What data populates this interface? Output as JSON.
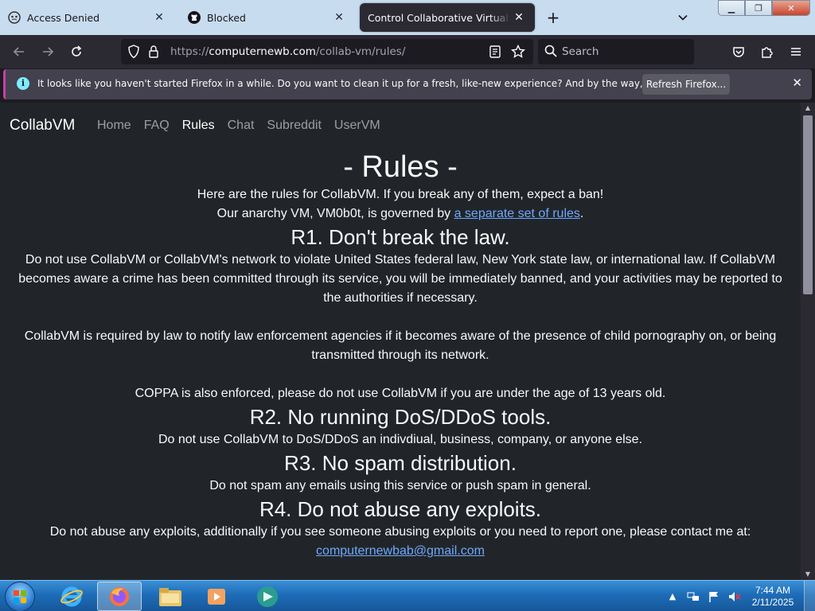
{
  "tabs": [
    {
      "label": "Access Denied",
      "icon": "mask-icon"
    },
    {
      "label": "Blocked",
      "icon": "github-icon"
    },
    {
      "label": "Control Collaborative Virtual Machi",
      "icon": "none",
      "active": true
    }
  ],
  "nav": {
    "url_prefix": "https://",
    "url_domain": "computernewb.com",
    "url_path": "/collab-vm/rules/",
    "search_placeholder": "Search"
  },
  "notification": {
    "message": "It looks like you haven't started Firefox in a while. Do you want to clean it up for a fresh, like-new experience? And by the way, welcome back!",
    "button_label": "Refresh Firefox..."
  },
  "site": {
    "brand": "CollabVM",
    "links": [
      {
        "label": "Home"
      },
      {
        "label": "FAQ"
      },
      {
        "label": "Rules",
        "active": true
      },
      {
        "label": "Chat"
      },
      {
        "label": "Subreddit"
      },
      {
        "label": "UserVM"
      }
    ]
  },
  "rules": {
    "title": "- Rules -",
    "intro1": "Here are the rules for CollabVM. If you break any of them, expect a ban!",
    "intro2_pre": "Our anarchy VM, VM0b0t, is governed by ",
    "intro2_link": "a separate set of rules",
    "intro2_post": ".",
    "r1_title": "R1. Don't break the law.",
    "r1_p1": "Do not use CollabVM or CollabVM's network to violate United States federal law, New York state law, or international law. If CollabVM becomes aware a crime has been committed through its service, you will be immediately banned, and your activities may be reported to the authorities if necessary.",
    "r1_p2": "CollabVM is required by law to notify law enforcement agencies if it becomes aware of the presence of child pornography on, or being transmitted through its network.",
    "r1_p3": "COPPA is also enforced, please do not use CollabVM if you are under the age of 13 years old.",
    "r2_title": "R2. No running DoS/DDoS tools.",
    "r2_p": "Do not use CollabVM to DoS/DDoS an indivdiual, business, company, or anyone else.",
    "r3_title": "R3. No spam distribution.",
    "r3_p": "Do not spam any emails using this service or push spam in general.",
    "r4_title": "R4. Do not abuse any exploits.",
    "r4_p": "Do not abuse any exploits, additionally if you see someone abusing exploits or you need to report one, please contact me at:",
    "r4_email": "computernewbab@gmail.com"
  },
  "taskbar": {
    "time": "7:44 AM",
    "date": "2/11/2025"
  },
  "colors": {
    "page_bg": "#212529",
    "link": "#6ea8fe",
    "notif_accent": "#c93fa6"
  }
}
